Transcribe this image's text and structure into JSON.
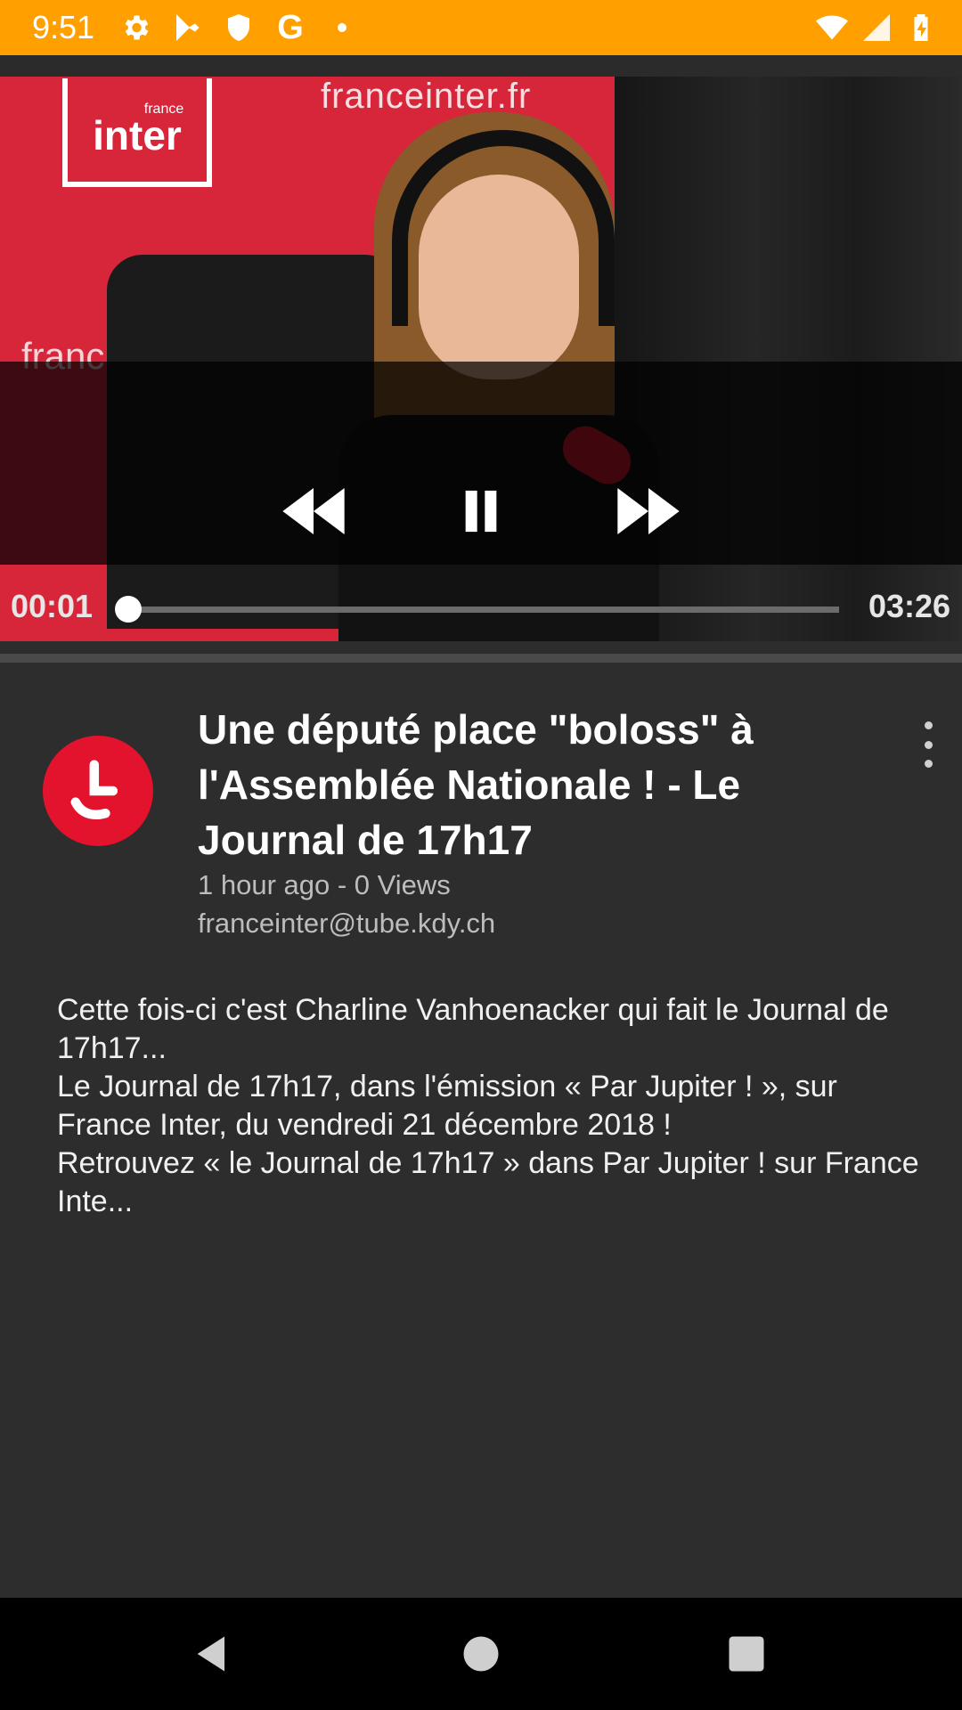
{
  "status_bar": {
    "time": "9:51",
    "left_icons": [
      "gear-icon",
      "play-store-icon",
      "shield-icon",
      "google-icon",
      "notification-dot-icon"
    ],
    "right_icons": [
      "wifi-icon",
      "cell-signal-icon",
      "battery-charging-icon"
    ],
    "background_color": "#ff9f00"
  },
  "video": {
    "wall_text_top": "franceinter.fr",
    "wall_text_side": "franc",
    "logo_small": "france",
    "logo_big": "inter",
    "player": {
      "current_time": "00:01",
      "duration": "03:26",
      "progress": 0.005,
      "buttons": [
        "rewind-icon",
        "pause-icon",
        "fast-forward-icon"
      ]
    }
  },
  "details": {
    "title": "Une député place \"boloss\" à l'Assemblée Nationale ! - Le Journal de 17h17",
    "meta": "1 hour ago - 0 Views",
    "channel": "franceinter@tube.kdy.ch",
    "avatar_color": "#e3122d",
    "description_lines": [
      "Cette fois-ci c'est Charline Vanhoenacker qui fait le Journal de 17h17...",
      "Le Journal de 17h17, dans l'émission « Par Jupiter ! », sur France Inter, du vendredi 21 décembre 2018 !",
      "Retrouvez « le Journal de 17h17 » dans Par Jupiter ! sur France Inte..."
    ]
  },
  "nav_bar": {
    "buttons": [
      "back-icon",
      "home-icon",
      "recents-icon"
    ]
  }
}
